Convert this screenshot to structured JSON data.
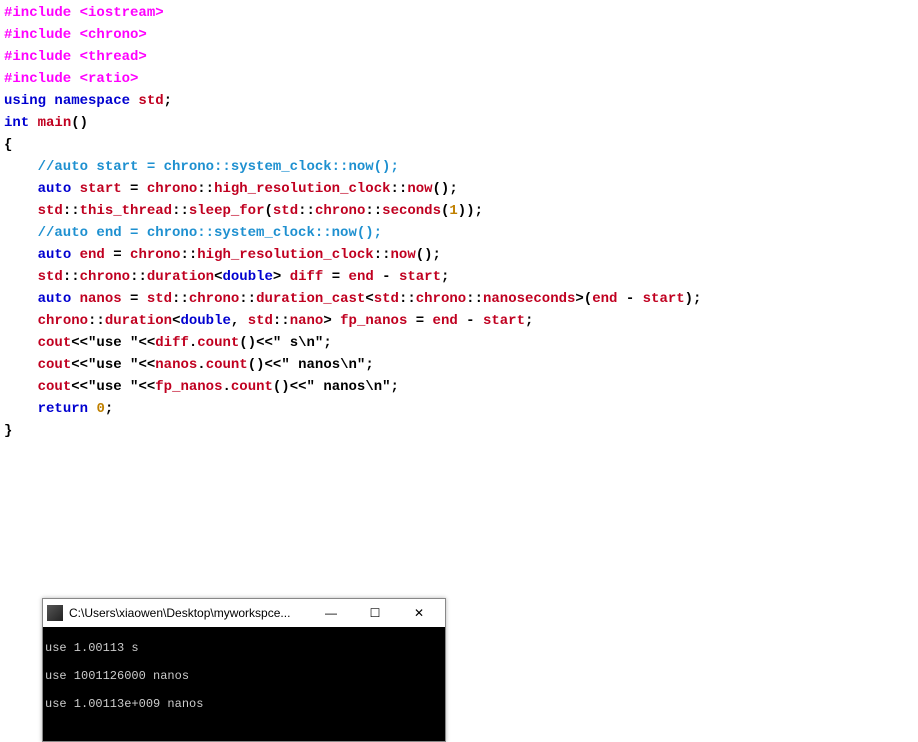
{
  "code": {
    "l1": {
      "a": "#include",
      "b": " <iostream>"
    },
    "l2": {
      "a": "#include",
      "b": " <chrono>"
    },
    "l3": {
      "a": "#include",
      "b": " <thread>"
    },
    "l4": {
      "a": "#include",
      "b": " <ratio>"
    },
    "l5": {
      "a": "using",
      "b": " namespace",
      "c": " std",
      "d": ";"
    },
    "l6": "",
    "l7": {
      "a": "int",
      "b": " main",
      "c": "()"
    },
    "l8": "{",
    "l9": "    //auto start = chrono::system_clock::now();",
    "l10": {
      "ind": "    ",
      "a": "auto",
      "b": " start ",
      "c": "=",
      "d": " chrono",
      "e": "::",
      "f": "high_resolution_clock",
      "g": "::",
      "h": "now",
      "i": "();"
    },
    "l11": {
      "ind": "    ",
      "a": "std",
      "b": "::",
      "c": "this_thread",
      "d": "::",
      "e": "sleep_for",
      "f": "(",
      "g": "std",
      "h": "::",
      "i": "chrono",
      "j": "::",
      "k": "seconds",
      "l": "(",
      "m": "1",
      "n": "));"
    },
    "l12": "    //auto end = chrono::system_clock::now();",
    "l13": {
      "ind": "    ",
      "a": "auto",
      "b": " end ",
      "c": "=",
      "d": " chrono",
      "e": "::",
      "f": "high_resolution_clock",
      "g": "::",
      "h": "now",
      "i": "();"
    },
    "l14": "",
    "l15": {
      "ind": "    ",
      "a": "std",
      "b": "::",
      "c": "chrono",
      "d": "::",
      "e": "duration",
      "f": "<",
      "g": "double",
      "h": ">",
      "i": " diff ",
      "j": "=",
      "k": " end ",
      "l": "-",
      "m": " start",
      "n": ";"
    },
    "l16": {
      "ind": "    ",
      "a": "auto",
      "b": " nanos ",
      "c": "=",
      "d": " std",
      "e": "::",
      "f": "chrono",
      "g": "::",
      "h": "duration_cast",
      "i": "<",
      "j": "std",
      "k": "::",
      "l": "chrono",
      "m": "::",
      "n": "nanoseconds",
      "o": ">(",
      "p": "end ",
      "q": "-",
      "r": " start",
      "s": ");"
    },
    "l17": {
      "ind": "    ",
      "a": "chrono",
      "b": "::",
      "c": "duration",
      "d": "<",
      "e": "double",
      "f": ",",
      "g": " std",
      "h": "::",
      "i": "nano",
      "j": ">",
      "k": " fp_nanos ",
      "l": "=",
      "m": " end ",
      "n": "-",
      "o": " start",
      "p": ";"
    },
    "l18": "",
    "l19": {
      "ind": "    ",
      "a": "cout",
      "b": "<<",
      "c": "\"use \"",
      "d": "<<",
      "e": "diff",
      "f": ".",
      "g": "count",
      "h": "()<<",
      "i": "\" s\\n\"",
      "j": ";"
    },
    "l20": {
      "ind": "    ",
      "a": "cout",
      "b": "<<",
      "c": "\"use \"",
      "d": "<<",
      "e": "nanos",
      "f": ".",
      "g": "count",
      "h": "()<<",
      "i": "\" nanos\\n\"",
      "j": ";"
    },
    "l21": {
      "ind": "    ",
      "a": "cout",
      "b": "<<",
      "c": "\"use \"",
      "d": "<<",
      "e": "fp_nanos",
      "f": ".",
      "g": "count",
      "h": "()<<",
      "i": "\" nanos\\n\"",
      "j": ";"
    },
    "l22": {
      "ind": "    ",
      "a": "return",
      "b": " ",
      "c": "0",
      "d": ";"
    },
    "l23": "}"
  },
  "console": {
    "title": "C:\\Users\\xiaowen\\Desktop\\myworkspce...",
    "lines": [
      "use 1.00113 s",
      "use 1001126000 nanos",
      "use 1.00113e+009 nanos"
    ],
    "btn_min": "—",
    "btn_max": "☐",
    "btn_close": "✕"
  }
}
